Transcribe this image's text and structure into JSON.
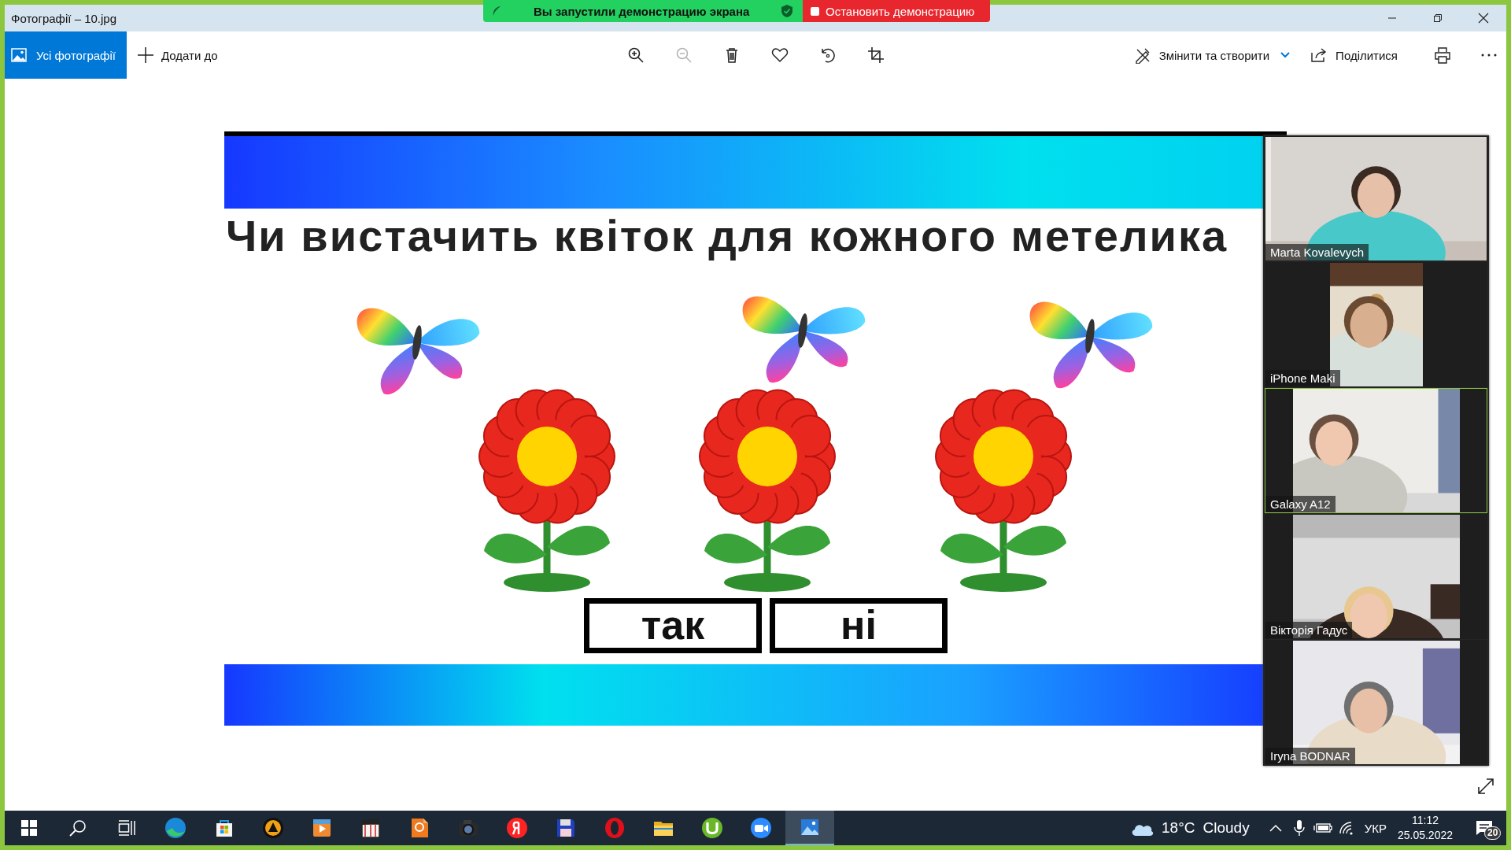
{
  "window": {
    "title": "Фотографії – 10.jpg"
  },
  "share_banner": {
    "status": "Вы запустили демонстрацию экрана",
    "stop_button": "Остановить демонстрацию"
  },
  "toolbar": {
    "all_photos": {
      "label": "Усі фотографії",
      "selected": true
    },
    "add_to": "Додати до",
    "tools": [
      {
        "disabled": false
      },
      {
        "disabled": true
      },
      {
        "disabled": false
      },
      {
        "disabled": false
      },
      {
        "disabled": false
      },
      {
        "disabled": false
      }
    ],
    "edit_create": "Змінити та створити",
    "share": "Поділитися"
  },
  "slide": {
    "question": "Чи вистачить квіток для кожного метелика",
    "answers": [
      "так",
      "ні"
    ]
  },
  "participants": [
    {
      "name": "Marta Kovalevych",
      "speaking": false
    },
    {
      "name": "iPhone Maki",
      "speaking": false
    },
    {
      "name": "Galaxy A12",
      "speaking": true
    },
    {
      "name": "Вікторія Гадус",
      "speaking": false
    },
    {
      "name": "Iryna BODNAR",
      "speaking": false
    }
  ],
  "taskbar": {
    "apps": [
      {
        "selected": false
      },
      {
        "selected": false
      },
      {
        "selected": false
      },
      {
        "selected": false
      },
      {
        "selected": false
      },
      {
        "selected": false
      },
      {
        "selected": false
      },
      {
        "selected": false
      },
      {
        "selected": false
      },
      {
        "selected": false
      },
      {
        "selected": false
      },
      {
        "selected": false
      },
      {
        "selected": false
      },
      {
        "selected": true
      }
    ],
    "weather": {
      "temperature": "18°C",
      "condition": "Cloudy"
    },
    "language": "УКР",
    "time": "11:12",
    "date": "25.05.2022",
    "notifications": "20"
  }
}
